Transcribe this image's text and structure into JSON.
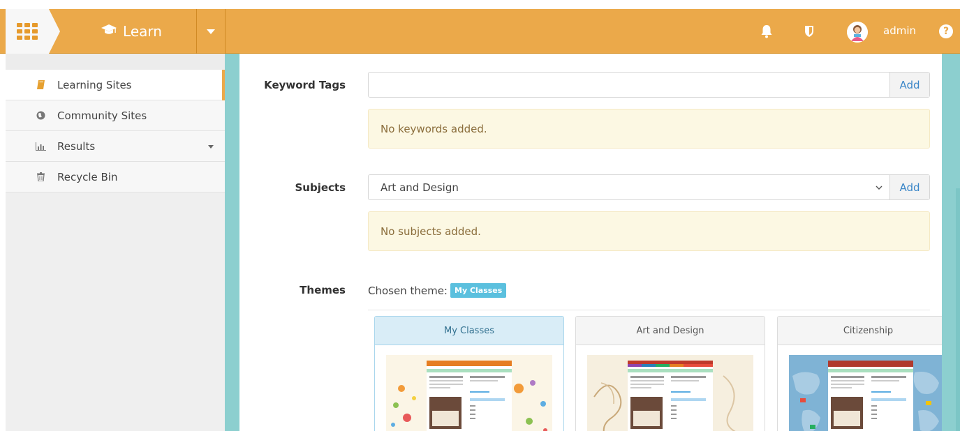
{
  "topbar": {
    "module_name": "Learn",
    "username": "admin",
    "help_label": "?",
    "icons": [
      "apps-grid-icon",
      "graduation-cap-icon",
      "chevron-down-icon",
      "bell-icon",
      "shield-icon",
      "avatar",
      "help-icon"
    ]
  },
  "sidebar": {
    "items": [
      {
        "label": "Learning Sites",
        "icon": "book-icon",
        "active": true
      },
      {
        "label": "Community Sites",
        "icon": "globe-icon",
        "active": false
      },
      {
        "label": "Results",
        "icon": "bar-chart-icon",
        "active": false,
        "has_dropdown": true
      },
      {
        "label": "Recycle Bin",
        "icon": "trash-icon",
        "active": false
      }
    ]
  },
  "form": {
    "keyword_tags": {
      "label": "Keyword Tags",
      "value": "",
      "add_label": "Add",
      "empty_message": "No keywords added."
    },
    "subjects": {
      "label": "Subjects",
      "selected": "Art and Design",
      "add_label": "Add",
      "empty_message": "No subjects added."
    },
    "themes": {
      "label": "Themes",
      "chosen_prefix": "Chosen theme:",
      "chosen_value": "My Classes",
      "cards": [
        {
          "title": "My Classes",
          "selected": true
        },
        {
          "title": "Art and Design",
          "selected": false
        },
        {
          "title": "Citizenship",
          "selected": false
        }
      ]
    }
  },
  "colors": {
    "topbar": "#eba94a",
    "frame": "#8ccfcf",
    "link": "#3a86c8",
    "alert_bg": "#fcf8e3",
    "alert_text": "#8a6d3b",
    "badge": "#5bc0de"
  }
}
